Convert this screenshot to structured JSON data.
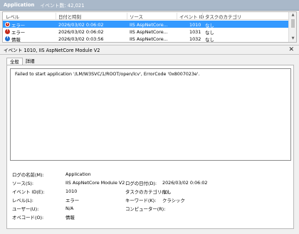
{
  "window": {
    "title": "Application",
    "count_text": "イベント数: 42,021"
  },
  "grid": {
    "columns": [
      "レベル",
      "日付と時刻",
      "ソース",
      "イベント ID",
      "タスクのカテゴリ"
    ],
    "rows": [
      {
        "level": "エラー",
        "level_icon": "error-icon",
        "datetime": "2026/03/02 0:06:02",
        "source": "IIS AspNetCore...",
        "event_id": "1010",
        "task": "なし",
        "selected": true
      },
      {
        "level": "エラー",
        "level_icon": "error-icon",
        "datetime": "2026/03/02 0:06:02",
        "source": "IIS AspNetCore...",
        "event_id": "1031",
        "task": "なし",
        "selected": false
      },
      {
        "level": "情報",
        "level_icon": "info-icon",
        "datetime": "2026/03/02 0:03:56",
        "source": "IIS AspNetCore...",
        "event_id": "1032",
        "task": "なし",
        "selected": false
      }
    ]
  },
  "detail": {
    "title": "イベント 1010, IIS AspNetCore Module V2",
    "close_glyph": "✕",
    "tabs": [
      "全般",
      "詳細"
    ],
    "message": "Failed to start application '/LM/W3SVC/1/ROOT/open/lcv', ErrorCode '0x8007023e'.",
    "props": {
      "log_name_label": "ログの名前(M):",
      "log_name_value": "Application",
      "source_label": "ソース(S):",
      "source_value": "IIS AspNetCore Module V2",
      "logged_label": "ログの日付(D):",
      "logged_value": "2026/03/02 0:06:02",
      "event_id_label": "イベント ID(E):",
      "event_id_value": "1010",
      "task_label": "タスクのカテゴリ(Y):",
      "task_value": "なし",
      "level_label": "レベル(L):",
      "level_value": "エラー",
      "keywords_label": "キーワード(K):",
      "keywords_value": "クラシック",
      "user_label": "ユーザー(U):",
      "user_value": "N/A",
      "computer_label": "コンピューター(R):",
      "computer_value": "",
      "opcode_label": "オペコード(O):",
      "opcode_value": "情報"
    }
  },
  "colors": {
    "titlebar": "#a9b8c9",
    "selection": "#3399ff",
    "error": "#c42b1c",
    "info": "#1f6fd1"
  }
}
